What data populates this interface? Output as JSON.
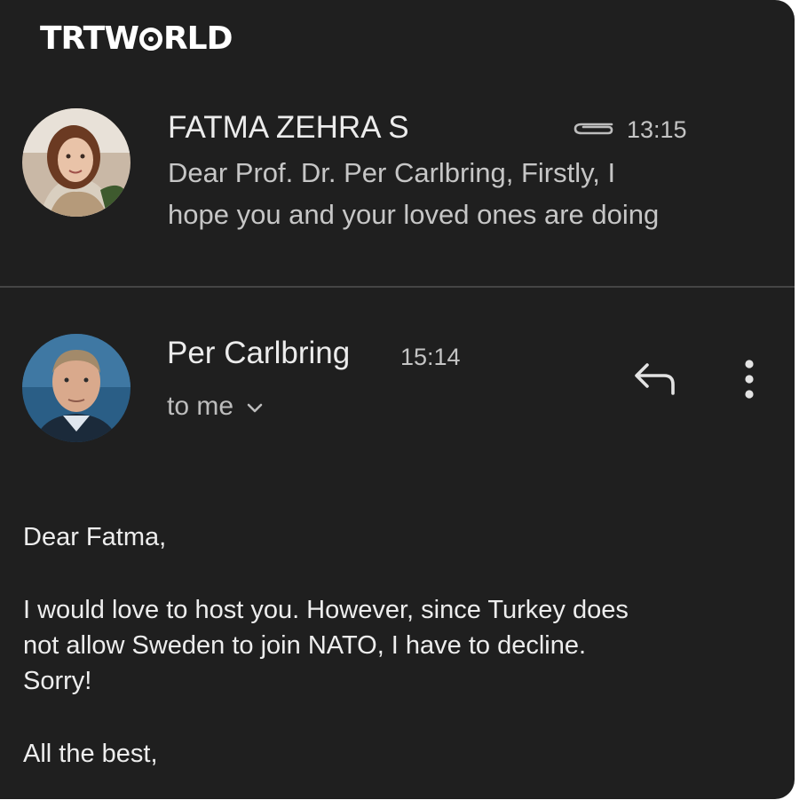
{
  "brand": {
    "logo_text_pre": "TRTW",
    "logo_text_post": "RLD"
  },
  "thread_item": {
    "sender": "FATMA ZEHRA S",
    "time": "13:15",
    "snippet_line1": "Dear Prof. Dr. Per Carlbring, Firstly, I",
    "snippet_line2": "hope you and your loved ones are doing",
    "has_attachment": true
  },
  "message": {
    "sender": "Per Carlbring",
    "time": "15:14",
    "recipient": "to me",
    "icons": {
      "reply": "reply-icon",
      "more": "more-vert-icon",
      "expand": "chevron-down-icon"
    },
    "body": {
      "greeting": "Dear Fatma,",
      "para_line1": "I would love to host you. However, since Turkey does",
      "para_line2": "not allow Sweden to join NATO, I have to decline.",
      "para_line3": "Sorry!",
      "closing": "All the best,"
    }
  },
  "colors": {
    "background": "#1f1f1f",
    "text": "#e3e3e3",
    "divider": "#454545"
  }
}
